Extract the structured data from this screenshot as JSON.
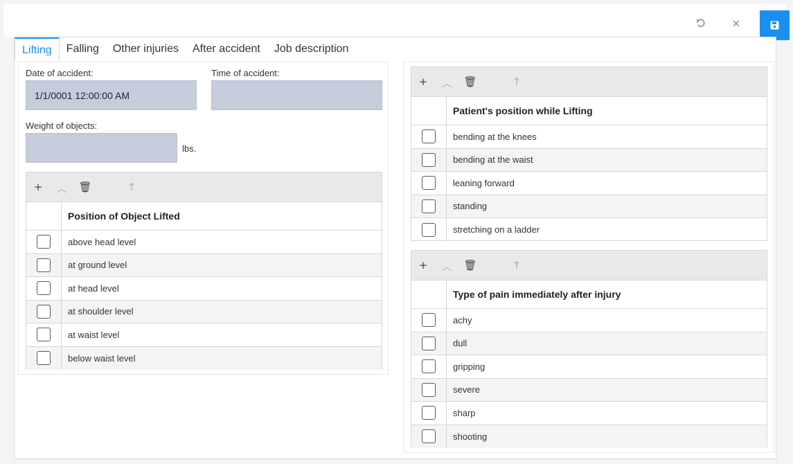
{
  "toolbar": {
    "undo_icon": "undo-icon",
    "close_icon": "close-icon",
    "save_icon": "save-icon",
    "accent": "#1a8ff0"
  },
  "tabs": [
    "Lifting",
    "Falling",
    "Other injuries",
    "After accident",
    "Job description"
  ],
  "form": {
    "date_label": "Date of accident:",
    "date_value": "1/1/0001 12:00:00 AM",
    "time_label": "Time of accident:",
    "time_value": "",
    "weight_label": "Weight of objects:",
    "weight_value": "",
    "weight_unit": "lbs."
  },
  "position_grid": {
    "header": "Position of Object Lifted",
    "rows": [
      "above head level",
      "at ground level",
      "at head level",
      "at shoulder level",
      "at waist level",
      "below waist level"
    ]
  },
  "patient_grid": {
    "header": "Patient's position while Lifting",
    "rows": [
      "bending at the knees",
      "bending at the waist",
      "leaning forward",
      "standing",
      "stretching on a ladder"
    ]
  },
  "pain_grid": {
    "header": "Type of pain immediately after injury",
    "rows": [
      "achy",
      "dull",
      "gripping",
      "severe",
      "sharp",
      "shooting"
    ]
  },
  "grid_toolbar_icons": [
    "add-icon",
    "collapse-icon",
    "delete-icon",
    "move-up-icon"
  ]
}
